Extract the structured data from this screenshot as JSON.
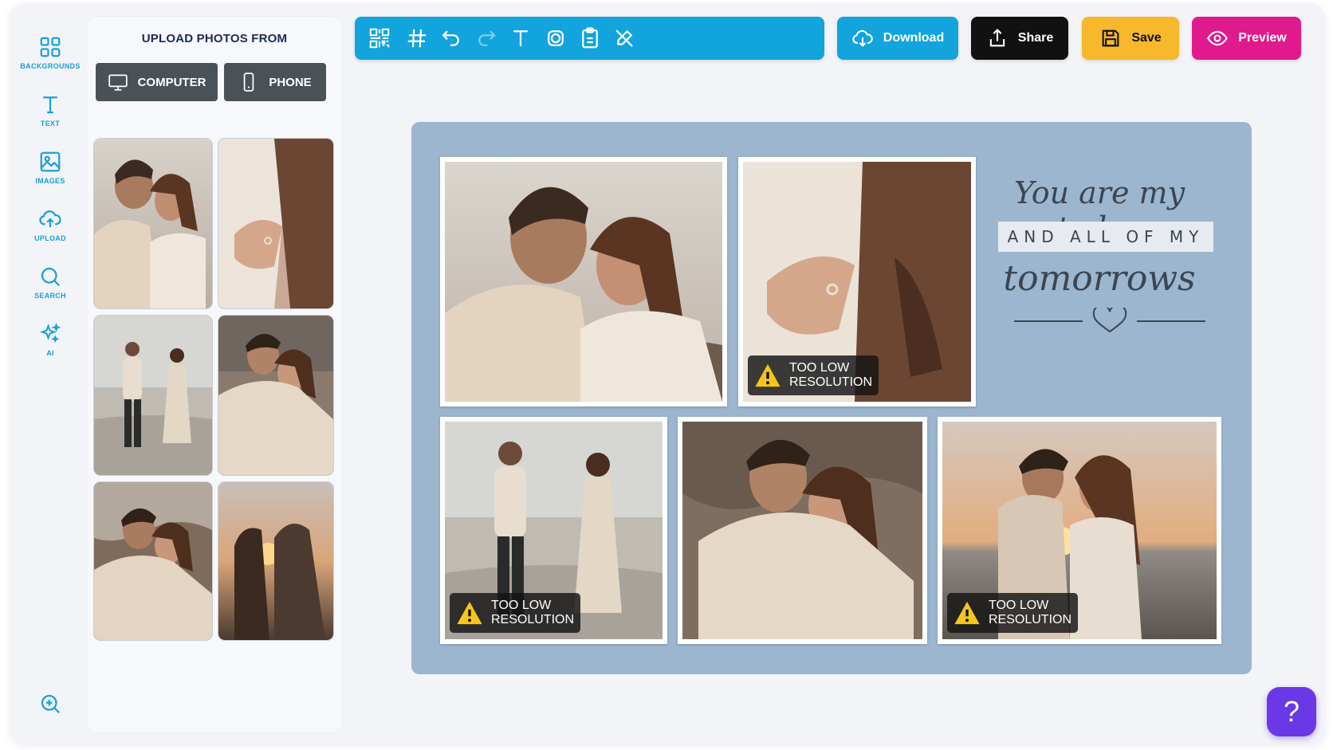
{
  "sidebar": {
    "items": [
      {
        "label": "BACKGROUNDS",
        "icon": "grid-icon"
      },
      {
        "label": "TEXT",
        "icon": "text-icon"
      },
      {
        "label": "IMAGES",
        "icon": "image-icon"
      },
      {
        "label": "UPLOAD",
        "icon": "cloud-upload-icon"
      },
      {
        "label": "SEARCH",
        "icon": "search-icon"
      },
      {
        "label": "AI",
        "icon": "sparkle-icon"
      }
    ],
    "zoom_icon": "zoom-in-icon"
  },
  "upload_panel": {
    "title": "UPLOAD PHOTOS FROM",
    "computer_label": "COMPUTER",
    "phone_label": "PHONE"
  },
  "toolbar": {
    "tools": [
      "qr-code-icon",
      "grid-hash-icon",
      "undo-icon",
      "redo-icon",
      "text-tool-icon",
      "shape-icon",
      "clipboard-icon",
      "no-edit-icon"
    ]
  },
  "actions": {
    "download_label": "Download",
    "share_label": "Share",
    "save_label": "Save",
    "preview_label": "Preview"
  },
  "colors": {
    "toolbar": "#12a4dd",
    "download": "#12a4dd",
    "share": "#111111",
    "save": "#f7b82b",
    "preview": "#e0198c",
    "canvas": "#9cb6cf",
    "help": "#6b38e8"
  },
  "canvas": {
    "warning_text_line1": "TOO LOW",
    "warning_text_line2": "RESOLUTION",
    "quote": {
      "line1": "You are my today",
      "line2": "AND ALL OF MY",
      "line3": "tomorrows"
    }
  },
  "help_label": "?"
}
